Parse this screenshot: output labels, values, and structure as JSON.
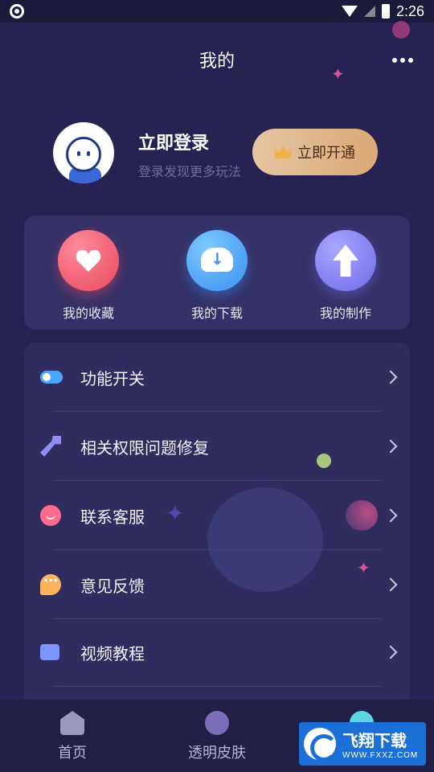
{
  "status_bar": {
    "time": "2:26"
  },
  "header": {
    "title": "我的"
  },
  "profile": {
    "login_title": "立即登录",
    "login_subtitle": "登录发现更多玩法",
    "vip_button": "立即开通"
  },
  "quick_actions": [
    {
      "label": "我的收藏",
      "icon": "heart-icon"
    },
    {
      "label": "我的下载",
      "icon": "cloud-download-icon"
    },
    {
      "label": "我的制作",
      "icon": "upload-arrow-icon"
    }
  ],
  "menu": [
    {
      "label": "功能开关",
      "icon": "toggle-icon"
    },
    {
      "label": "相关权限问题修复",
      "icon": "wrench-icon"
    },
    {
      "label": "联系客服",
      "icon": "customer-service-icon"
    },
    {
      "label": "意见反馈",
      "icon": "feedback-icon"
    },
    {
      "label": "视频教程",
      "icon": "video-icon"
    }
  ],
  "tabbar": [
    {
      "label": "首页",
      "icon": "home-icon"
    },
    {
      "label": "透明皮肤",
      "icon": "skin-icon"
    },
    {
      "label": "",
      "icon": "mine-icon"
    }
  ],
  "watermark": {
    "name": "飞翔下载",
    "url": "WWW.FXXZ.COM"
  },
  "colors": {
    "background": "#262352",
    "card": "#353166",
    "vip_gold": "#e7c5a1",
    "accent_red": "#e7475e",
    "accent_blue": "#3a8ff2",
    "accent_purple": "#6e6ae8"
  }
}
